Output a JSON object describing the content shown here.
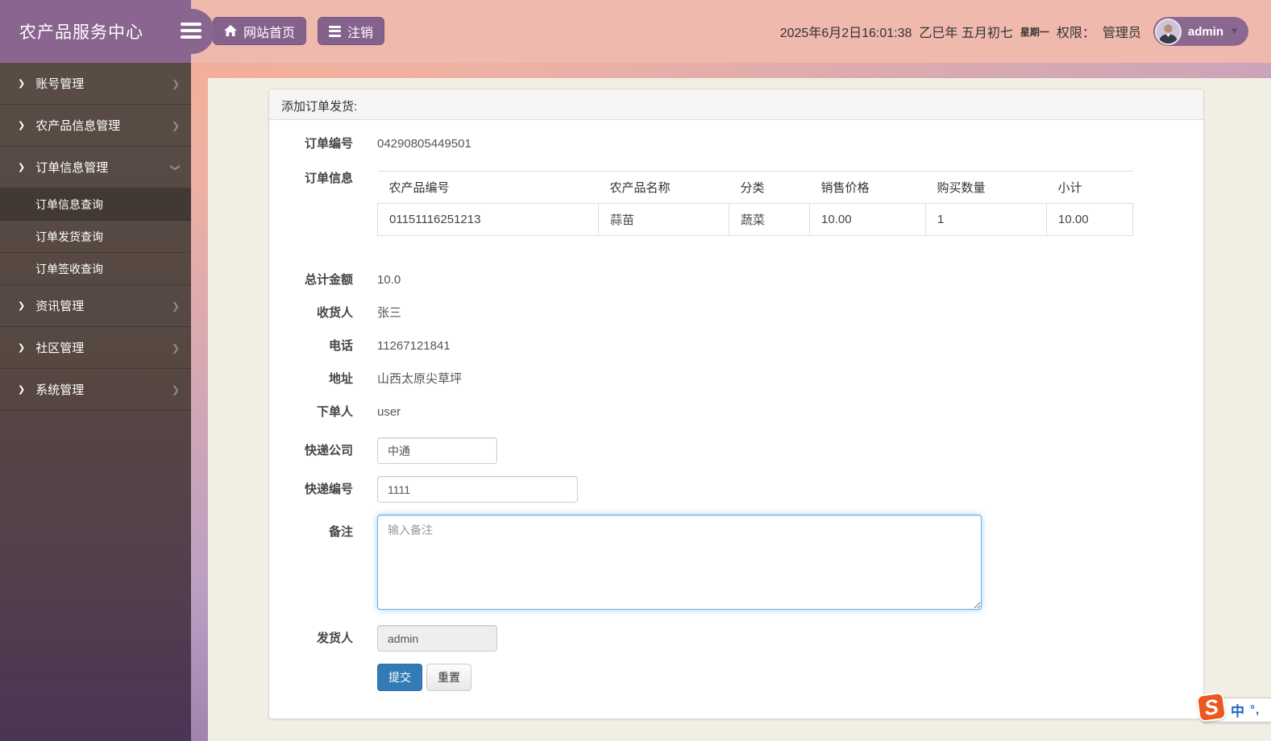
{
  "brand": {
    "title": "农产品服务中心"
  },
  "navbar": {
    "home_button": "网站首页",
    "logout_button": "注销",
    "datetime": "2025年6月2日16:01:38",
    "lunar": "乙巳年 五月初七",
    "weekday": "星期一",
    "permission_label": "权限：",
    "role": "管理员",
    "username": "admin"
  },
  "sidebar": {
    "items": [
      {
        "label": "账号管理"
      },
      {
        "label": "农产品信息管理"
      },
      {
        "label": "订单信息管理",
        "expanded": true,
        "children": [
          "订单信息查询",
          "订单发货查询",
          "订单签收查询"
        ],
        "active_child": "订单信息查询"
      },
      {
        "label": "资讯管理"
      },
      {
        "label": "社区管理"
      },
      {
        "label": "系统管理"
      }
    ]
  },
  "form": {
    "title": "添加订单发货:",
    "order_no": {
      "label": "订单编号",
      "value": "04290805449501"
    },
    "order_info_label": "订单信息",
    "table": {
      "headers": [
        "农产品编号",
        "农产品名称",
        "分类",
        "销售价格",
        "购买数量",
        "小计"
      ],
      "rows": [
        [
          "01151116251213",
          "蒜苗",
          "蔬菜",
          "10.00",
          "1",
          "10.00"
        ]
      ]
    },
    "fields_static": [
      {
        "label": "总计金额",
        "value": "10.0"
      },
      {
        "label": "收货人",
        "value": "张三"
      },
      {
        "label": "电话",
        "value": "11267121841"
      },
      {
        "label": "地址",
        "value": "山西太原尖草坪"
      },
      {
        "label": "下单人",
        "value": "user"
      }
    ],
    "express_company": {
      "label": "快递公司",
      "value": "中通"
    },
    "express_no": {
      "label": "快递编号",
      "value": "1111"
    },
    "remark": {
      "label": "备注",
      "placeholder": "输入备注"
    },
    "shipper": {
      "label": "发货人",
      "value": "admin"
    },
    "submit_label": "提交",
    "reset_label": "重置"
  },
  "ime": {
    "badge": "S",
    "mode": "中",
    "punct": "°,"
  },
  "colors": {
    "brand_purple": "#8a6590",
    "navbar_pink": "#f0b9ae",
    "button_purple": "#84628c",
    "content_cream": "#f1efe3",
    "sidebar_brown": "#564741",
    "primary_blue": "#337ab7",
    "focus_blue": "#66afe9",
    "ime_orange": "#eb5820"
  }
}
